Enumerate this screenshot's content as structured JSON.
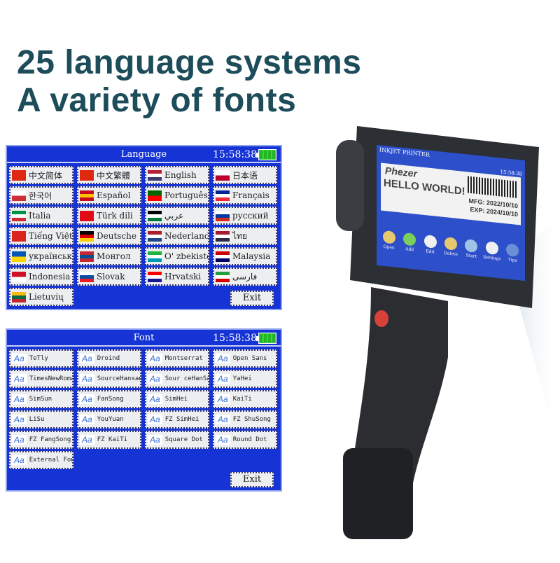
{
  "headline": {
    "line1": "25 language systems",
    "line2": "A variety of fonts"
  },
  "colors": {
    "headline": "#1d4c5a",
    "panel": "#1634d6",
    "battery": "#3fd33f"
  },
  "language_panel": {
    "title": "Language",
    "clock": "15:58:38",
    "exit_label": "Exit",
    "items": [
      {
        "label": "中文简体",
        "flag": [
          "#de2910"
        ]
      },
      {
        "label": "中文繁體",
        "flag": [
          "#de2910"
        ]
      },
      {
        "label": "English",
        "flag": [
          "#b22234",
          "#ffffff",
          "#3c3b6e"
        ]
      },
      {
        "label": "日本语",
        "flag": [
          "#ffffff",
          "#bc002d"
        ]
      },
      {
        "label": "한국어",
        "flag": [
          "#ffffff",
          "#cd2e3a"
        ]
      },
      {
        "label": "Español",
        "flag": [
          "#c60b1e",
          "#ffc400",
          "#c60b1e"
        ]
      },
      {
        "label": "Português",
        "flag": [
          "#006600",
          "#ff0000"
        ]
      },
      {
        "label": "Français",
        "flag": [
          "#002395",
          "#ffffff",
          "#ed2939"
        ]
      },
      {
        "label": "Italia",
        "flag": [
          "#009246",
          "#ffffff",
          "#ce2b37"
        ]
      },
      {
        "label": "Türk dili",
        "flag": [
          "#e30a17"
        ]
      },
      {
        "label": "عربي",
        "flag": [
          "#000000",
          "#ffffff",
          "#007a3d"
        ]
      },
      {
        "label": "русский",
        "flag": [
          "#ffffff",
          "#0039a6",
          "#d52b1e"
        ]
      },
      {
        "label": "Tiếng Việt",
        "flag": [
          "#da251d"
        ]
      },
      {
        "label": "Deutsche",
        "flag": [
          "#000000",
          "#dd0000",
          "#ffce00"
        ]
      },
      {
        "label": "Nederland",
        "flag": [
          "#ae1c28",
          "#ffffff",
          "#21468b"
        ]
      },
      {
        "label": "ไทย",
        "flag": [
          "#a51931",
          "#ffffff",
          "#2d2a4a"
        ]
      },
      {
        "label": "українська",
        "flag": [
          "#0057b7",
          "#ffd700"
        ]
      },
      {
        "label": "Монгол",
        "flag": [
          "#c4272f",
          "#015197",
          "#c4272f"
        ]
      },
      {
        "label": "O' zbekiston",
        "flag": [
          "#1eb53a",
          "#ffffff",
          "#0099b5"
        ]
      },
      {
        "label": "Malaysia",
        "flag": [
          "#cc0001",
          "#ffffff",
          "#010066"
        ]
      },
      {
        "label": "Indonesia",
        "flag": [
          "#ce1126",
          "#ffffff"
        ]
      },
      {
        "label": "Slovak",
        "flag": [
          "#ffffff",
          "#0b4ea2",
          "#ee1c25"
        ]
      },
      {
        "label": "Hrvatski",
        "flag": [
          "#ff0000",
          "#ffffff",
          "#171796"
        ]
      },
      {
        "label": "فارسی",
        "flag": [
          "#239f40",
          "#ffffff",
          "#da0000"
        ]
      },
      {
        "label": "Lietuvių",
        "flag": [
          "#fdb913",
          "#006a44",
          "#c1272d"
        ]
      }
    ]
  },
  "font_panel": {
    "title": "Font",
    "clock": "15:58:38",
    "exit_label": "Exit",
    "icon_text": "Aa",
    "items": [
      "TeTly",
      "Droind",
      "Montserrat",
      "Open Sans",
      "TimesNewRoman",
      "SourceHansans",
      "Sour ceHanSans",
      "YaHei",
      "SimSun",
      "FanSong",
      "SimHei",
      "KaiTi",
      "LiSu",
      "YouYuan",
      "FZ SimHei",
      "FZ ShuSong",
      "FZ FangSong",
      "FZ KaiTi",
      "Square Dot",
      "Round Dot",
      "External Font"
    ]
  },
  "device_screen": {
    "header": "INKJET PRINTER",
    "clock": "15:58:38",
    "brand": "Phezer",
    "message": "HELLO WORLD!",
    "mfg": "MFG: 2022/10/10",
    "exp": "EXP:  2024/10/10",
    "toolbar": [
      "Open",
      "Add",
      "Edit",
      "Delete",
      "Start",
      "Settings",
      "Tips"
    ]
  }
}
